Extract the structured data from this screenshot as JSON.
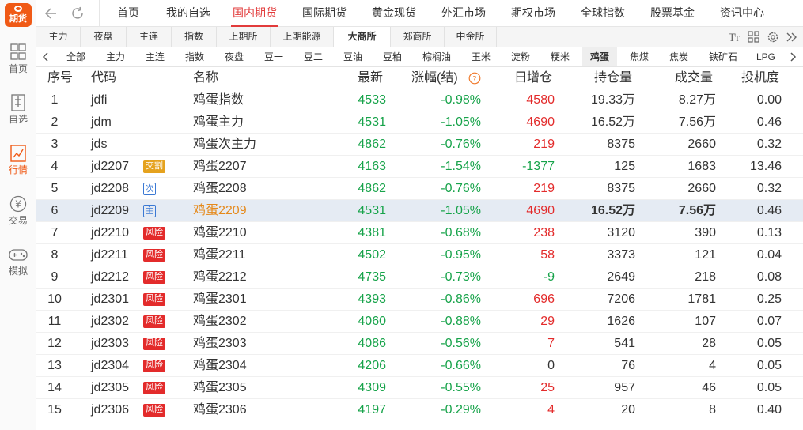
{
  "brand": {
    "logo_text": "期货"
  },
  "sidebar": {
    "items": [
      {
        "label": "首页",
        "icon": "home-grid-icon",
        "active": false
      },
      {
        "label": "自选",
        "icon": "watchlist-icon",
        "active": false
      },
      {
        "label": "行情",
        "icon": "market-chart-icon",
        "active": true
      },
      {
        "label": "交易",
        "icon": "trade-yen-icon",
        "active": false
      },
      {
        "label": "模拟",
        "icon": "gamepad-icon",
        "active": false
      }
    ]
  },
  "topnav": {
    "tabs": [
      "首页",
      "我的自选",
      "国内期货",
      "国际期货",
      "黄金现货",
      "外汇市场",
      "期权市场",
      "全球指数",
      "股票基金",
      "资讯中心"
    ],
    "active": "国内期货"
  },
  "exchanges": {
    "tabs": [
      "主力",
      "夜盘",
      "主连",
      "指数",
      "上期所",
      "上期能源",
      "大商所",
      "郑商所",
      "中金所"
    ],
    "active": "大商所",
    "tools": [
      "font-size-icon",
      "layout-grid-icon",
      "settings-gear-icon",
      "double-chevron-right-icon"
    ]
  },
  "products": {
    "tabs": [
      "全部",
      "主力",
      "主连",
      "指数",
      "夜盘",
      "豆一",
      "豆二",
      "豆油",
      "豆粕",
      "棕榈油",
      "玉米",
      "淀粉",
      "粳米",
      "鸡蛋",
      "焦煤",
      "焦炭",
      "铁矿石",
      "LPG"
    ],
    "active": "鸡蛋"
  },
  "table": {
    "headers": {
      "index": "序号",
      "code": "代码",
      "name": "名称",
      "last": "最新",
      "change": "涨幅(结)",
      "oi_change": "日增仓",
      "open_interest": "持仓量",
      "volume": "成交量",
      "speculation": "投机度"
    },
    "rows": [
      {
        "index": "1",
        "code": "jdfi",
        "tag": "",
        "name": "鸡蛋指数",
        "last": "4533",
        "change": "-0.98%",
        "oi_change": "4580",
        "open_interest": "19.33万",
        "volume": "8.27万",
        "speculation": "0.00",
        "edge": ""
      },
      {
        "index": "2",
        "code": "jdm",
        "tag": "",
        "name": "鸡蛋主力",
        "last": "4531",
        "change": "-1.05%",
        "oi_change": "4690",
        "open_interest": "16.52万",
        "volume": "7.56万",
        "speculation": "0.46",
        "edge": ""
      },
      {
        "index": "3",
        "code": "jds",
        "tag": "",
        "name": "鸡蛋次主力",
        "last": "4862",
        "change": "-0.76%",
        "oi_change": "219",
        "open_interest": "8375",
        "volume": "2660",
        "speculation": "0.32",
        "edge": ""
      },
      {
        "index": "4",
        "code": "jd2207",
        "tag": "交割",
        "name": "鸡蛋2207",
        "last": "4163",
        "change": "-1.54%",
        "oi_change": "-1377",
        "open_interest": "125",
        "volume": "1683",
        "speculation": "13.46",
        "edge": ""
      },
      {
        "index": "5",
        "code": "jd2208",
        "tag": "次",
        "name": "鸡蛋2208",
        "last": "4862",
        "change": "-0.76%",
        "oi_change": "219",
        "open_interest": "8375",
        "volume": "2660",
        "speculation": "0.32",
        "edge": ""
      },
      {
        "index": "6",
        "code": "jd2209",
        "tag": "主",
        "name": "鸡蛋2209",
        "last": "4531",
        "change": "-1.05%",
        "oi_change": "4690",
        "open_interest": "16.52万",
        "volume": "7.56万",
        "speculation": "0.46",
        "edge": ""
      },
      {
        "index": "7",
        "code": "jd2210",
        "tag": "风险",
        "name": "鸡蛋2210",
        "last": "4381",
        "change": "-0.68%",
        "oi_change": "238",
        "open_interest": "3120",
        "volume": "390",
        "speculation": "0.13",
        "edge": ""
      },
      {
        "index": "8",
        "code": "jd2211",
        "tag": "风险",
        "name": "鸡蛋2211",
        "last": "4502",
        "change": "-0.95%",
        "oi_change": "58",
        "open_interest": "3373",
        "volume": "121",
        "speculation": "0.04",
        "edge": ""
      },
      {
        "index": "9",
        "code": "jd2212",
        "tag": "风险",
        "name": "鸡蛋2212",
        "last": "4735",
        "change": "-0.73%",
        "oi_change": "-9",
        "open_interest": "2649",
        "volume": "218",
        "speculation": "0.08",
        "edge": ""
      },
      {
        "index": "10",
        "code": "jd2301",
        "tag": "风险",
        "name": "鸡蛋2301",
        "last": "4393",
        "change": "-0.86%",
        "oi_change": "696",
        "open_interest": "7206",
        "volume": "1781",
        "speculation": "0.25",
        "edge": ""
      },
      {
        "index": "11",
        "code": "jd2302",
        "tag": "风险",
        "name": "鸡蛋2302",
        "last": "4060",
        "change": "-0.88%",
        "oi_change": "29",
        "open_interest": "1626",
        "volume": "107",
        "speculation": "0.07",
        "edge": ""
      },
      {
        "index": "12",
        "code": "jd2303",
        "tag": "风险",
        "name": "鸡蛋2303",
        "last": "4086",
        "change": "-0.56%",
        "oi_change": "7",
        "open_interest": "541",
        "volume": "28",
        "speculation": "0.05",
        "edge": ""
      },
      {
        "index": "13",
        "code": "jd2304",
        "tag": "风险",
        "name": "鸡蛋2304",
        "last": "4206",
        "change": "-0.66%",
        "oi_change": "0",
        "open_interest": "76",
        "volume": "4",
        "speculation": "0.05",
        "edge": ""
      },
      {
        "index": "14",
        "code": "jd2305",
        "tag": "风险",
        "name": "鸡蛋2305",
        "last": "4309",
        "change": "-0.55%",
        "oi_change": "25",
        "open_interest": "957",
        "volume": "46",
        "speculation": "0.05",
        "edge": ""
      },
      {
        "index": "15",
        "code": "jd2306",
        "tag": "风险",
        "name": "鸡蛋2306",
        "last": "4197",
        "change": "-0.29%",
        "oi_change": "4",
        "open_interest": "20",
        "volume": "8",
        "speculation": "0.40",
        "edge": ""
      }
    ],
    "selected_index": "6"
  },
  "colors": {
    "brand": "#f05a16",
    "up": "#e32b2b",
    "down": "#17a34a",
    "selected_row": "#e5ebf3",
    "risk_tag": "#e32b2b"
  }
}
